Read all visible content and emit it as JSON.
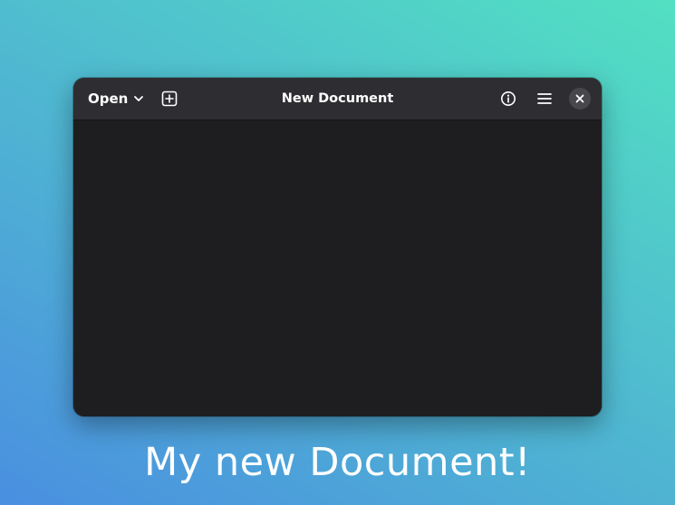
{
  "window": {
    "title": "New Document",
    "open_button_label": "Open",
    "icons": {
      "open_dropdown": "chevron-down-icon",
      "new_tab": "tab-new-icon",
      "info": "info-icon",
      "menu": "hamburger-menu-icon",
      "close": "close-icon"
    }
  },
  "caption": {
    "text": "My new Document!"
  },
  "colors": {
    "headerbar": "#2e2e32",
    "content": "#1e1e20",
    "close_button_bg": "#48484c",
    "gradient_start": "#4a8fe0",
    "gradient_end": "#52e0c2"
  }
}
